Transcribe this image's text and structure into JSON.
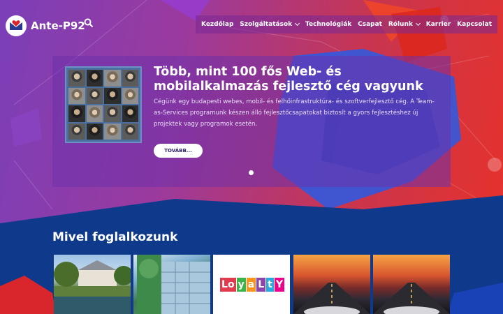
{
  "brand": {
    "name": "Ante-P92",
    "logo_icon": "heart-envelope-icon"
  },
  "nav": {
    "items": [
      {
        "label": "Kezdőlap",
        "dropdown": false
      },
      {
        "label": "Szolgáltatások",
        "dropdown": true
      },
      {
        "label": "Technológiák",
        "dropdown": false
      },
      {
        "label": "Csapat",
        "dropdown": false
      },
      {
        "label": "Rólunk",
        "dropdown": true
      },
      {
        "label": "Karrier",
        "dropdown": false
      },
      {
        "label": "Kapcsolat",
        "dropdown": false
      }
    ],
    "search_icon": "search-icon"
  },
  "hero": {
    "title": "Több, mint 100 fős Web- és mobilalkalmazás fejlesztő cég vagyunk",
    "text": "Cégünk egy budapesti webes, mobil- és felhőinfrastruktúra- és szoftverfejlesztő cég. A Team-as-Services programunk készen álló fejlesztőcsapatokat biztosít a gyors fejlesztéshez új projektek vagy programok esetén.",
    "button_label": "TOVÁBB..."
  },
  "services": {
    "title": "Mivel foglalkozunk",
    "loyalty_letters": [
      "Lo",
      "y",
      "a",
      "L",
      "t",
      "Y"
    ]
  },
  "colors": {
    "hero_gradient_start": "#7b3fb8",
    "hero_gradient_end": "#e5322c",
    "section_bg": "#0f3a8c",
    "menu_bg": "#7a2896"
  }
}
